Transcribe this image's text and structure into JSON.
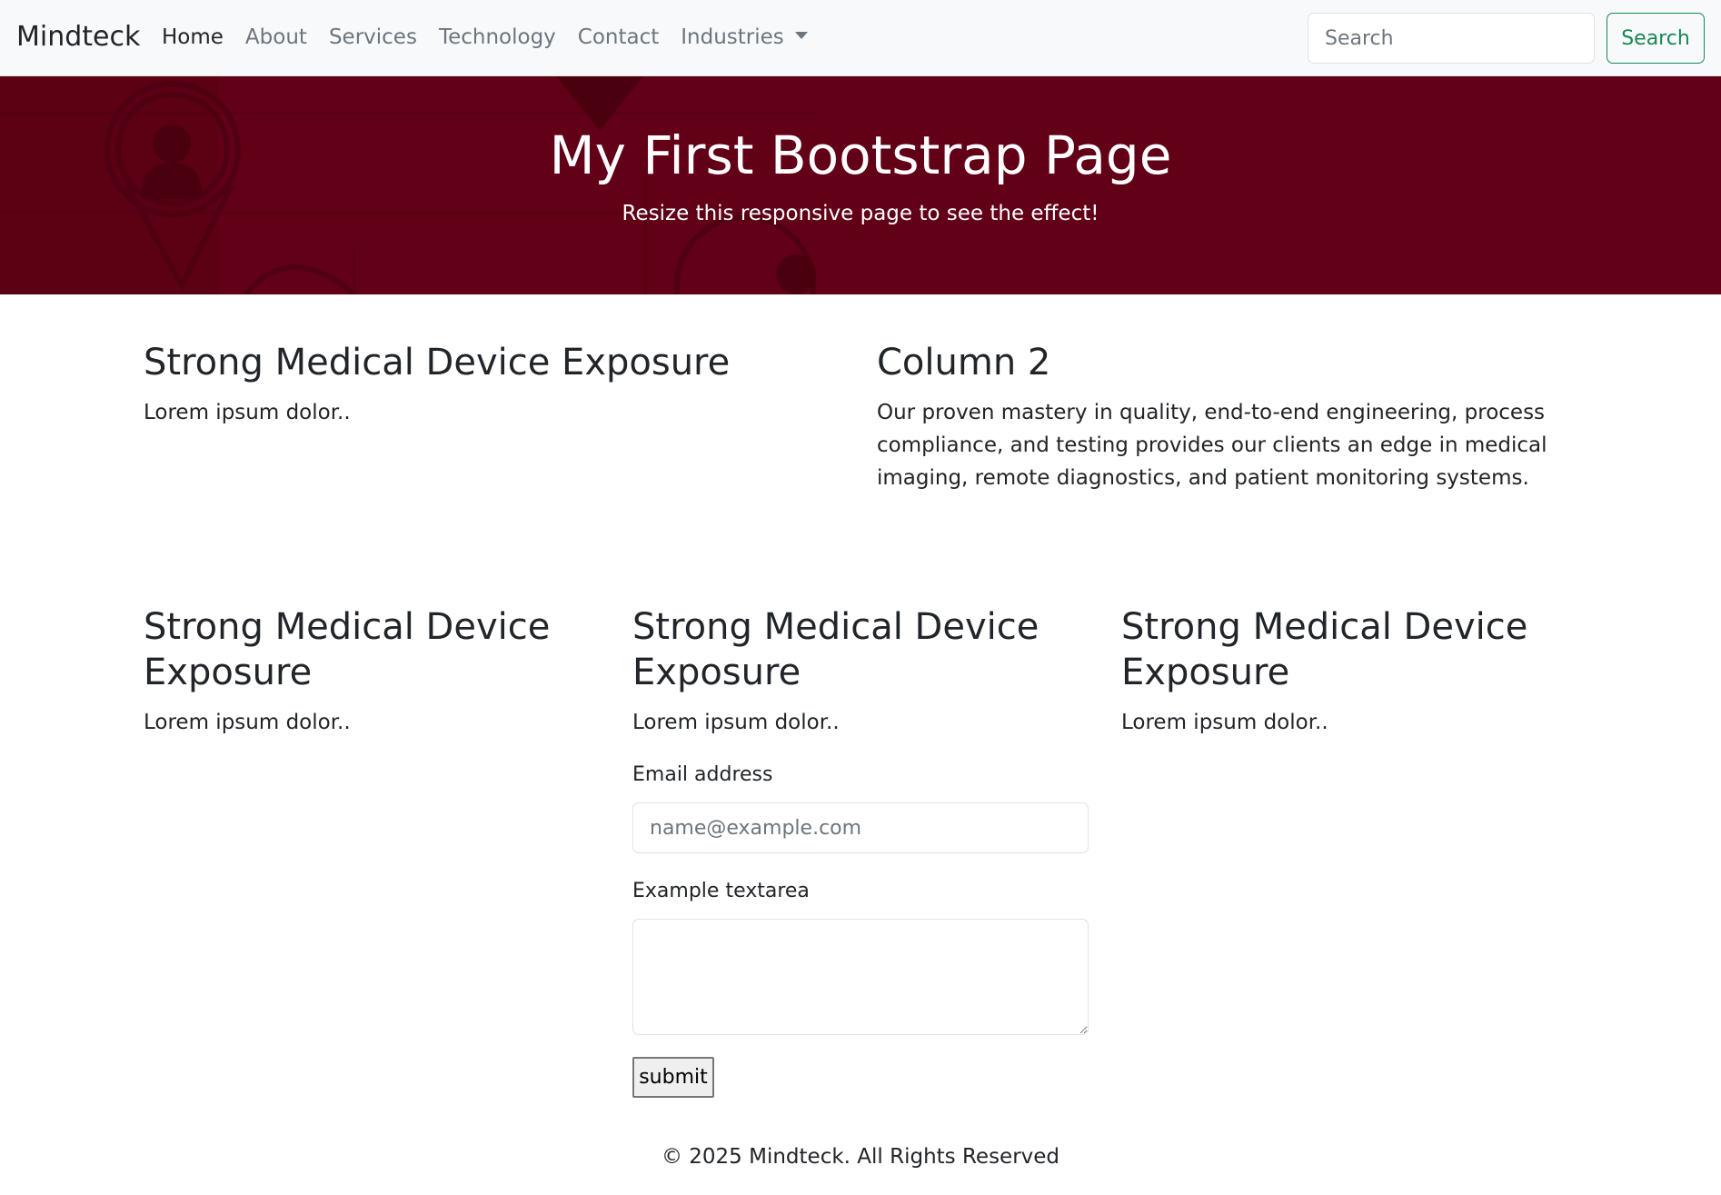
{
  "navbar": {
    "brand": "Mindteck",
    "links": [
      "Home",
      "About",
      "Services",
      "Technology",
      "Contact",
      "Industries"
    ],
    "search_placeholder": "Search",
    "search_button": "Search"
  },
  "hero": {
    "title": "My First Bootstrap Page",
    "subtitle": "Resize this responsive page to see the effect!",
    "background_color": "#620018"
  },
  "row1": {
    "col1": {
      "heading": "Strong Medical Device Exposure",
      "text": "Lorem ipsum dolor.."
    },
    "col2": {
      "heading": "Column 2",
      "text": "Our proven mastery in quality, end-to-end engineering, process compliance, and testing provides our clients an edge in medical imaging, remote diagnostics, and patient monitoring systems."
    }
  },
  "row2": {
    "col1": {
      "heading": "Strong Medical Device Exposure",
      "text": "Lorem ipsum dolor.."
    },
    "col2": {
      "heading": "Strong Medical Device Exposure",
      "text": "Lorem ipsum dolor.."
    },
    "col3": {
      "heading": "Strong Medical Device Exposure",
      "text": "Lorem ipsum dolor.."
    }
  },
  "form": {
    "email_label": "Email address",
    "email_placeholder": "name@example.com",
    "textarea_label": "Example textarea",
    "submit_label": "submit"
  },
  "footer": {
    "text": "© 2025 Mindteck. All Rights Reserved"
  },
  "colors": {
    "navbar_bg": "#f8f9fa",
    "success": "#198754",
    "text": "#212529",
    "muted": "#6c757d"
  }
}
